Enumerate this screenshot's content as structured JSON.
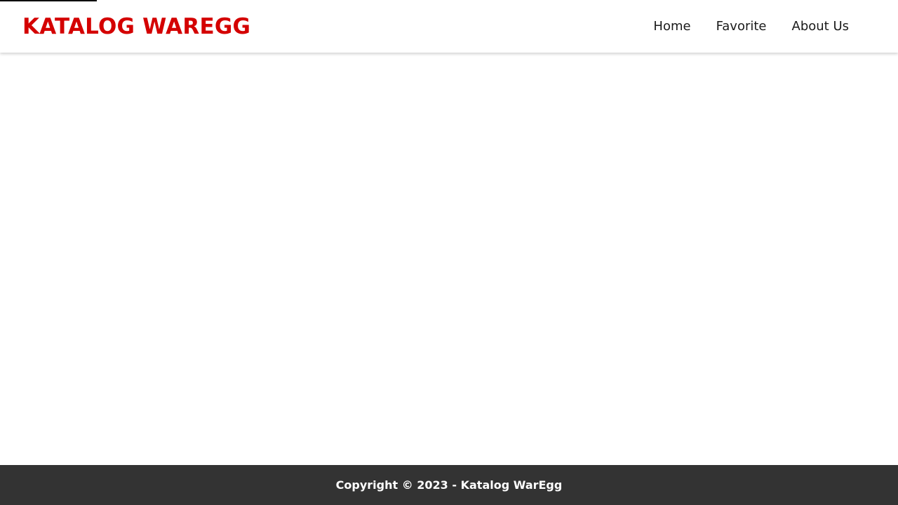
{
  "header": {
    "brand": "KATALOG WAREGG",
    "nav": [
      {
        "label": "Home"
      },
      {
        "label": "Favorite"
      },
      {
        "label": "About Us"
      }
    ]
  },
  "footer": {
    "copyright": "Copyright © 2023 - Katalog WarEgg"
  },
  "colors": {
    "brand": "#d40000",
    "footer_bg": "#333333",
    "nav_text": "#1a1a1a"
  }
}
